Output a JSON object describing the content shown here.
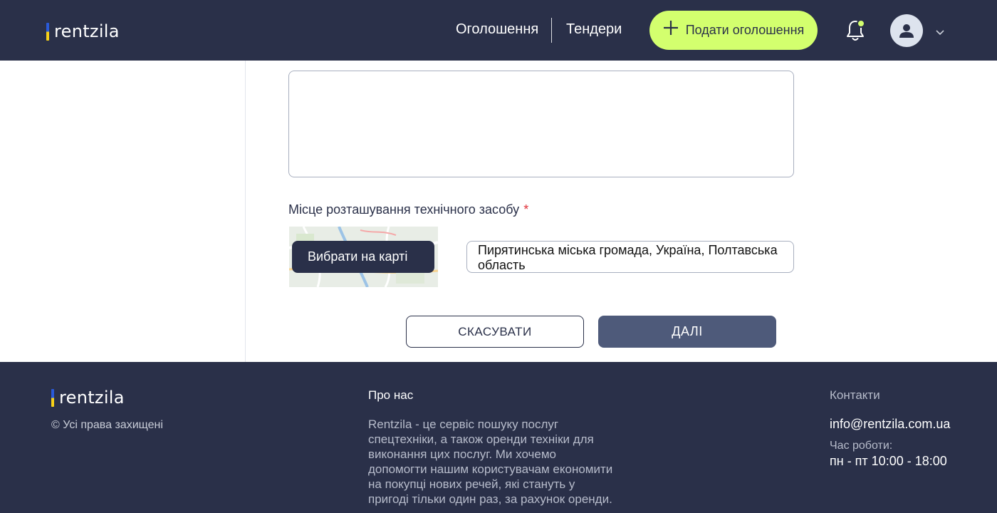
{
  "header": {
    "logo_text": "rentzila",
    "nav": {
      "ads": "Оголошення",
      "tenders": "Тендери"
    },
    "post_button": "Подати оголошення",
    "post_button_icon": "plus-icon",
    "notifications_icon": "bell-icon",
    "avatar_icon": "user-icon",
    "menu_icon": "chevron-down-icon",
    "accent_color": "#d3ff6e",
    "bg_color": "#2a3049"
  },
  "form": {
    "location_label": "Місце розташування технічного засобу",
    "required_mark": "*",
    "map_button": "Вибрати на карті",
    "address_value": "Пирятинська міська громада, Україна, Полтавська область",
    "cancel_button": "СКАСУВАТИ",
    "next_button": "ДАЛІ"
  },
  "footer": {
    "logo_text": "rentzila",
    "copyright": "© Усі права захищені",
    "about_title": "Про нас",
    "about_text": "Rentzila - це сервіс пошуку послуг спецтехніки, а також оренди техніки для виконання цих послуг. Ми хочемо допомогти нашим користувачам економити на покупці нових речей, які стануть у пригоді тільки один раз, за рахунок оренди.",
    "contacts_title": "Контакти",
    "email": "info@rentzila.com.ua",
    "hours_label": "Час роботи:",
    "hours_value": "пн - пт 10:00 - 18:00"
  }
}
